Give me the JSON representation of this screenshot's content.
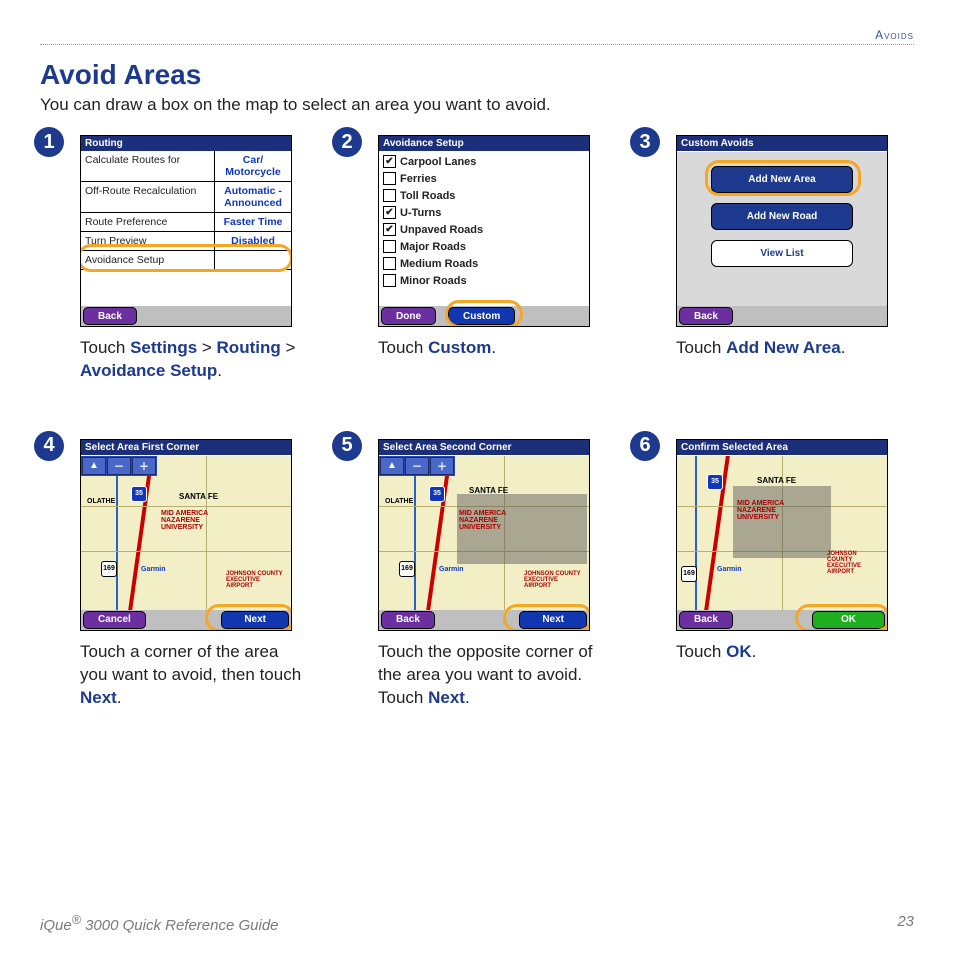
{
  "header": {
    "section": "Avoids"
  },
  "title": "Avoid Areas",
  "intro": "You can draw a box on the map to select an area you want to avoid.",
  "steps": {
    "s1": {
      "num": "1",
      "title": "Routing",
      "rows": [
        {
          "label": "Calculate Routes for",
          "value": "Car/ Motorcycle"
        },
        {
          "label": "Off-Route Recalculation",
          "value": "Automatic - Announced"
        },
        {
          "label": "Route Preference",
          "value": "Faster Time"
        },
        {
          "label": "Turn Preview",
          "value": "Disabled"
        },
        {
          "label": "Avoidance Setup",
          "value": ""
        }
      ],
      "back": "Back",
      "caption": {
        "pre": "Touch ",
        "b1": "Settings",
        "sep1": " > ",
        "b2": "Routing",
        "sep2": " > ",
        "b3": "Avoidance Setup",
        "post": "."
      }
    },
    "s2": {
      "num": "2",
      "title": "Avoidance Setup",
      "items": [
        {
          "label": "Carpool Lanes",
          "checked": true
        },
        {
          "label": "Ferries",
          "checked": false
        },
        {
          "label": "Toll Roads",
          "checked": false
        },
        {
          "label": "U-Turns",
          "checked": true
        },
        {
          "label": "Unpaved Roads",
          "checked": true
        },
        {
          "label": "Major Roads",
          "checked": false
        },
        {
          "label": "Medium Roads",
          "checked": false
        },
        {
          "label": "Minor Roads",
          "checked": false
        }
      ],
      "done": "Done",
      "custom": "Custom",
      "caption": {
        "pre": "Touch ",
        "b1": "Custom",
        "post": "."
      }
    },
    "s3": {
      "num": "3",
      "title": "Custom Avoids",
      "btns": {
        "area": "Add New Area",
        "road": "Add New Road",
        "list": "View List"
      },
      "back": "Back",
      "caption": {
        "pre": "Touch ",
        "b1": "Add New Area",
        "post": "."
      }
    },
    "s4": {
      "num": "4",
      "title": "Select Area First Corner",
      "cancel": "Cancel",
      "next": "Next",
      "caption": {
        "pre": "Touch a corner of the area you want to avoid, then touch ",
        "b1": "Next",
        "post": "."
      }
    },
    "s5": {
      "num": "5",
      "title": "Select Area Second Corner",
      "back": "Back",
      "next": "Next",
      "caption": {
        "pre": "Touch the opposite corner of the area you want to avoid. Touch ",
        "b1": "Next",
        "post": "."
      }
    },
    "s6": {
      "num": "6",
      "title": "Confirm Selected Area",
      "back": "Back",
      "ok": "OK",
      "caption": {
        "pre": "Touch ",
        "b1": "OK",
        "post": "."
      }
    }
  },
  "map": {
    "olathe": "OLATHE",
    "santafe": "SANTA FE",
    "mid": "MID AMERICA NAZARENE UNIVERSITY",
    "garmin": "Garmin",
    "jc": "JOHNSON COUNTY EXECUTIVE AIRPORT",
    "i35": "35",
    "hw169": "169"
  },
  "footer": {
    "left_pre": "iQue",
    "left_reg": "®",
    "left_post": " 3000 Quick Reference Guide",
    "page": "23"
  }
}
